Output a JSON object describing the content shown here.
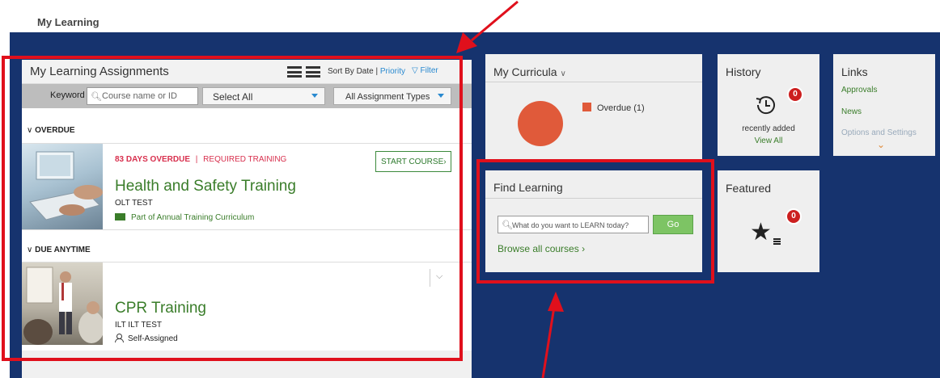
{
  "page": {
    "title": "My Learning"
  },
  "assignments": {
    "title": "My Learning Assignments",
    "sort": "Sort By Date |",
    "sort_priority": "Priority",
    "filter": "Filter",
    "keyword_label": "Keyword",
    "keyword_placeholder": "Course name or ID",
    "select_all": "Select All",
    "assignment_types": "All Assignment Types",
    "sections": {
      "overdue": "OVERDUE",
      "due_anytime": "DUE ANYTIME"
    },
    "items": [
      {
        "status": "83 DAYS OVERDUE",
        "separator": "|",
        "required": "REQUIRED TRAINING",
        "action": "START COURSE",
        "title": "Health and Safety Training",
        "subtitle": "OLT TEST",
        "curriculum": "Part of Annual Training Curriculum"
      },
      {
        "title": "CPR Training",
        "subtitle": "ILT ILT TEST",
        "assigned": "Self-Assigned"
      }
    ]
  },
  "tiles": {
    "curricula": {
      "title": "My Curricula",
      "legend": "Overdue (1)",
      "overdue_count": 1
    },
    "history": {
      "title": "History",
      "badge": "0",
      "recent": "recently added",
      "view_all": "View All"
    },
    "links": {
      "title": "Links",
      "items": [
        "Approvals",
        "News",
        "Options and Settings"
      ]
    },
    "find_learning": {
      "title": "Find Learning",
      "placeholder": "What do you want to LEARN today?",
      "go": "Go",
      "browse": "Browse all courses"
    },
    "featured": {
      "title": "Featured",
      "badge": "0"
    }
  },
  "colors": {
    "background_blue": "#16336e",
    "annotation_red": "#e0101c",
    "overdue_red": "#d8304e",
    "course_green": "#3a7d2a",
    "go_green": "#7dc464",
    "chart_orange": "#e05a3a",
    "badge_red": "#cc1f1f"
  }
}
